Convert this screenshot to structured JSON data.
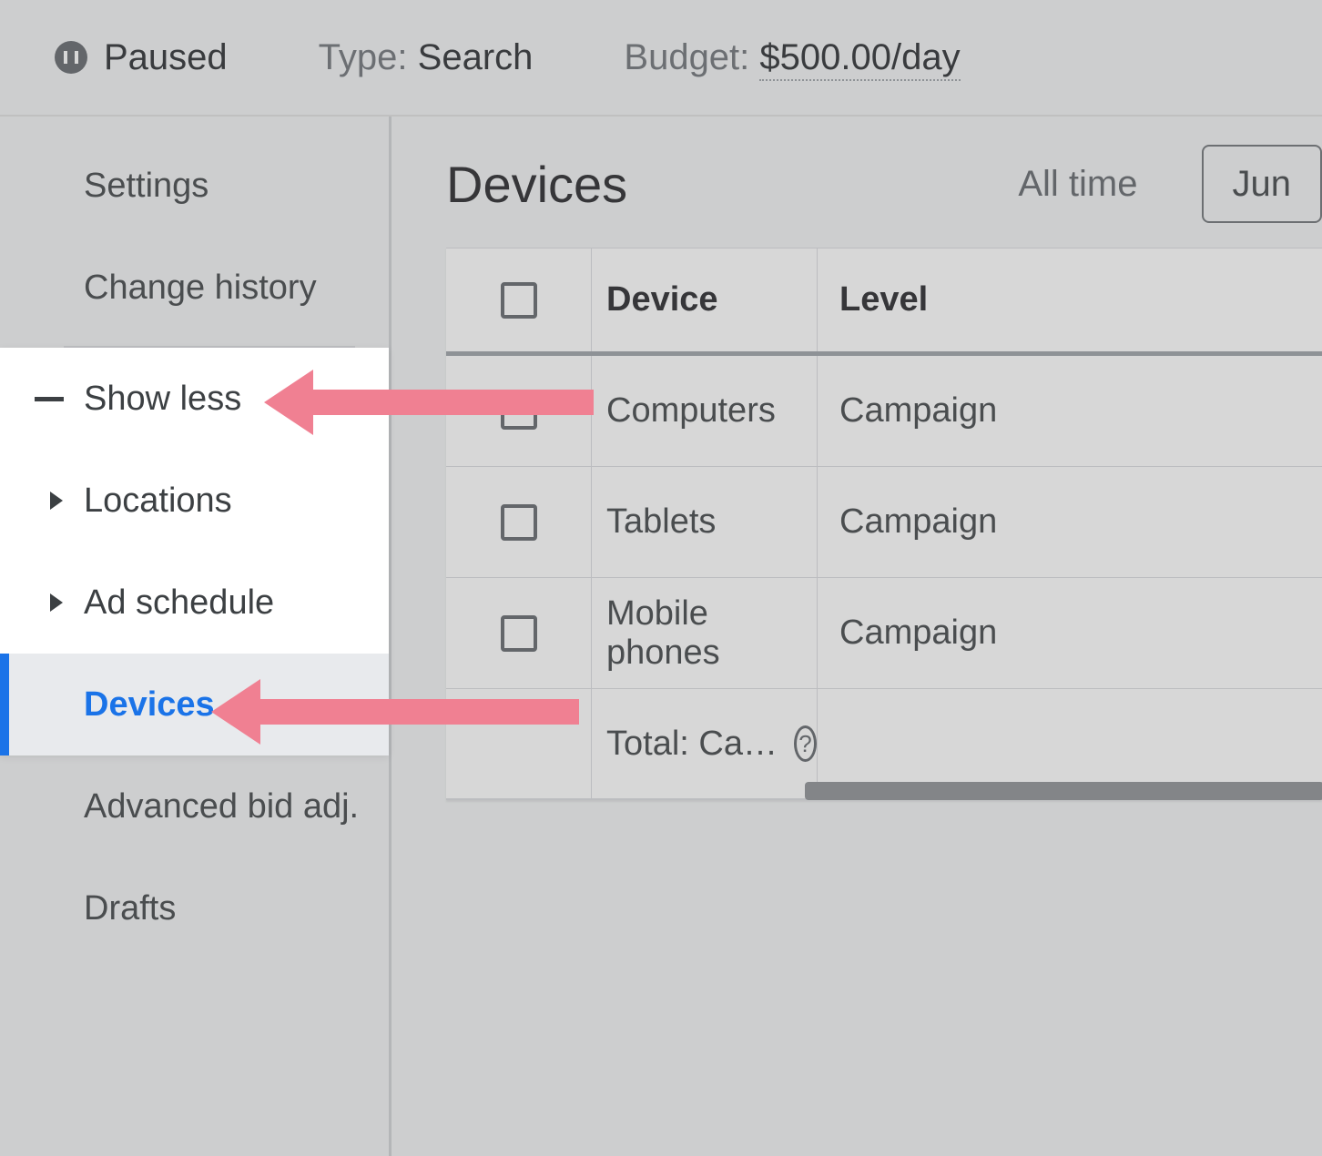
{
  "header": {
    "status": "Paused",
    "type_label": "Type:",
    "type_value": "Search",
    "budget_label": "Budget:",
    "budget_value": "$500.00/day"
  },
  "sidebar": {
    "items": [
      {
        "label": "Settings"
      },
      {
        "label": "Change history"
      },
      {
        "label": "Show less"
      },
      {
        "label": "Locations"
      },
      {
        "label": "Ad schedule"
      },
      {
        "label": "Devices"
      },
      {
        "label": "Advanced bid adj."
      },
      {
        "label": "Drafts"
      }
    ]
  },
  "content": {
    "title": "Devices",
    "time_filter": "All time",
    "date_range": "Jun",
    "table": {
      "headers": {
        "device": "Device",
        "level": "Level"
      },
      "rows": [
        {
          "device": "Computers",
          "level": "Campaign"
        },
        {
          "device": "Tablets",
          "level": "Campaign"
        },
        {
          "device": "Mobile phones",
          "level": "Campaign"
        }
      ],
      "total_label": "Total: Ca…"
    }
  }
}
